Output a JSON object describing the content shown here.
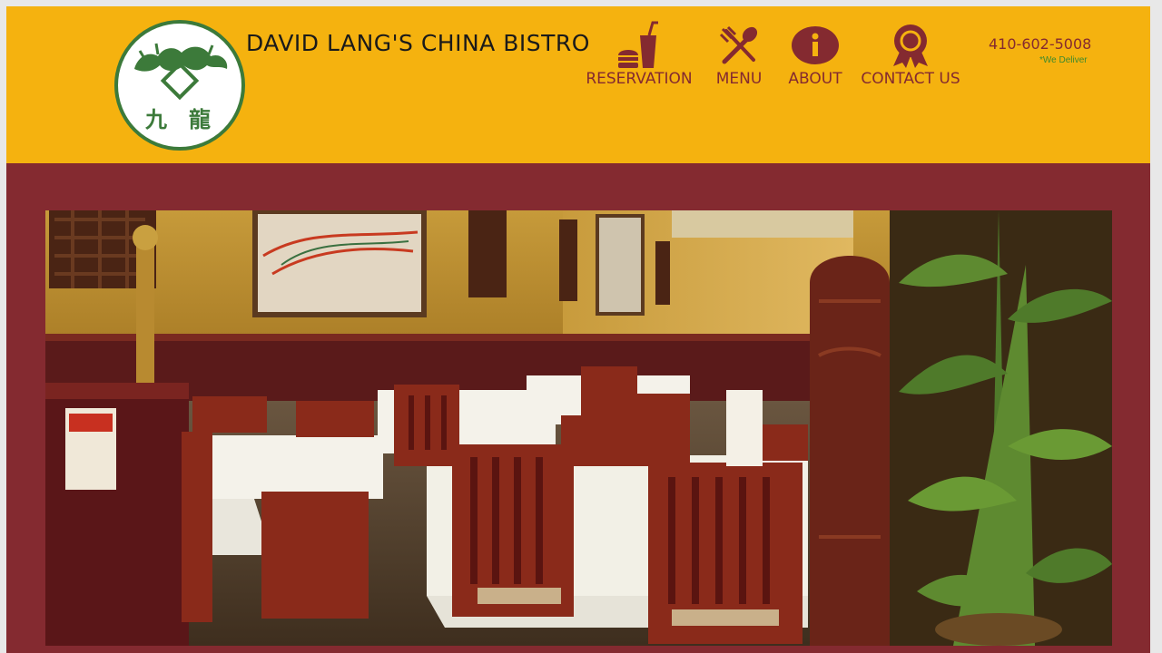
{
  "site": {
    "title": "DAVID LANG'S CHINA BISTRO",
    "logo_chars": [
      "九",
      "龍"
    ]
  },
  "nav": {
    "items": [
      {
        "label": "RESERVATION",
        "icon": "drink-burger-icon"
      },
      {
        "label": "MENU",
        "icon": "fork-spoon-icon"
      },
      {
        "label": "ABOUT",
        "icon": "info-icon"
      },
      {
        "label": "CONTACT US",
        "icon": "award-ribbon-icon"
      }
    ]
  },
  "contact": {
    "phone": "410-602-5008",
    "delivery_note": "*We Deliver"
  },
  "colors": {
    "header_bg": "#f5b20f",
    "accent_maroon": "#842a30",
    "logo_green": "#3c7a3a"
  }
}
